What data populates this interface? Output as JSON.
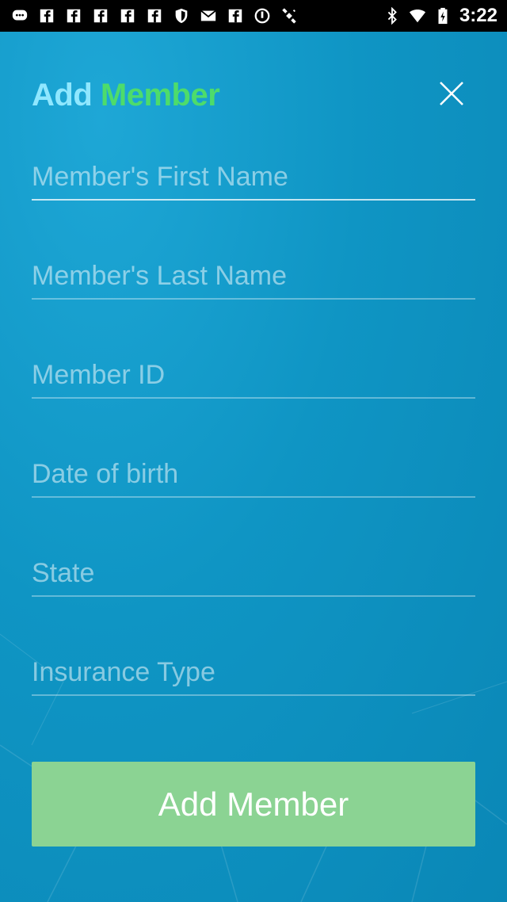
{
  "status_bar": {
    "time": "3:22",
    "left_icons": [
      "chat-icon",
      "facebook-icon",
      "facebook-icon",
      "facebook-icon",
      "facebook-icon",
      "facebook-icon",
      "shield-icon",
      "mail-icon",
      "facebook-icon",
      "circle-icon",
      "satellite-icon"
    ],
    "right_icons": [
      "bluetooth-icon",
      "wifi-icon",
      "battery-icon"
    ]
  },
  "header": {
    "title_part1": "Add",
    "title_part2": "Member",
    "title_color1": "#8fe7ff",
    "title_color2": "#4ddc6b"
  },
  "form": {
    "first_name": {
      "value": "",
      "placeholder": "Member's First Name"
    },
    "last_name": {
      "value": "",
      "placeholder": "Member's Last Name"
    },
    "member_id": {
      "value": "",
      "placeholder": "Member ID"
    },
    "dob": {
      "value": "",
      "placeholder": "Date of birth"
    },
    "state": {
      "value": "",
      "placeholder": "State"
    },
    "insurance_type": {
      "value": "",
      "placeholder": "Insurance Type"
    }
  },
  "submit": {
    "label": "Add Member",
    "color": "#8bd393"
  }
}
